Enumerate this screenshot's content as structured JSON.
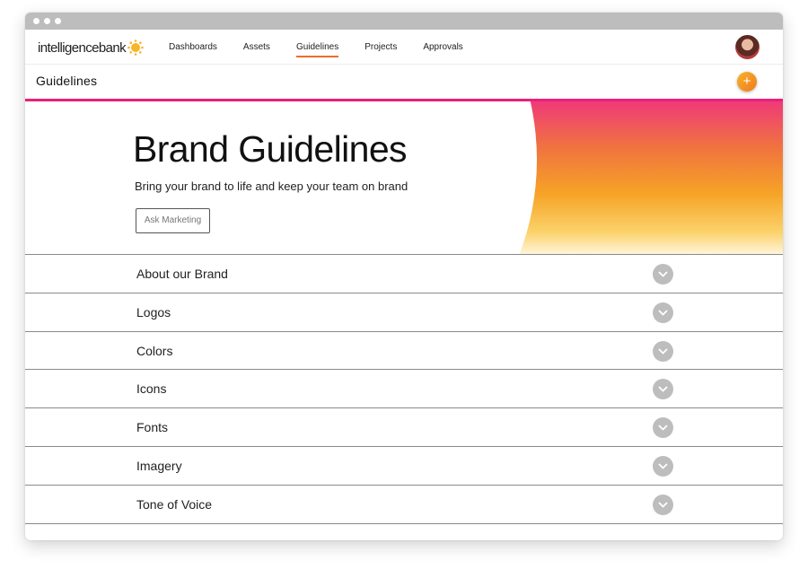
{
  "app": {
    "logo_part1": "intelligence",
    "logo_part2": "bank"
  },
  "nav": {
    "items": [
      {
        "label": "Dashboards",
        "active": false
      },
      {
        "label": "Assets",
        "active": false
      },
      {
        "label": "Guidelines",
        "active": true
      },
      {
        "label": "Projects",
        "active": false
      },
      {
        "label": "Approvals",
        "active": false
      }
    ]
  },
  "subheader": {
    "title": "Guidelines",
    "add_label": "+"
  },
  "hero": {
    "title": "Brand Guidelines",
    "subtitle": "Bring your brand to life and keep your team on brand",
    "button_label": "Ask Marketing"
  },
  "sections": [
    {
      "label": "About our Brand"
    },
    {
      "label": "Logos"
    },
    {
      "label": "Colors"
    },
    {
      "label": "Icons"
    },
    {
      "label": "Fonts"
    },
    {
      "label": "Imagery"
    },
    {
      "label": "Tone of Voice"
    }
  ],
  "colors": {
    "accent": "#ea1f7a",
    "nav_underline": "#f26b2c",
    "add_button": "#f39a25",
    "chevron_bg": "#bdbdbd"
  },
  "icons": {
    "logo": "sun-icon",
    "add": "plus-icon",
    "expand": "chevron-down-icon"
  }
}
